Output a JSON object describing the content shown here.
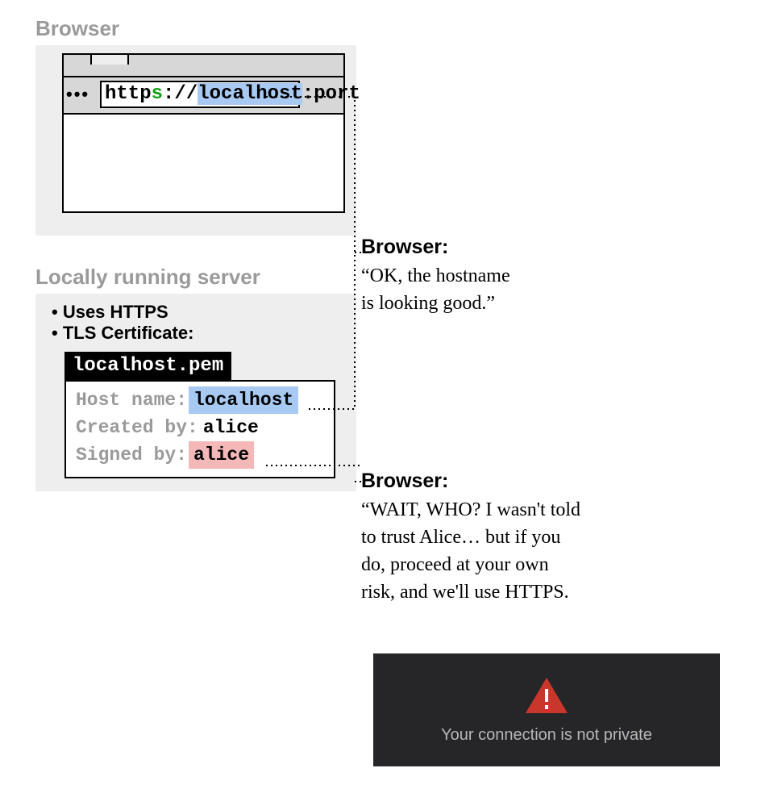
{
  "browser": {
    "title": "Browser",
    "dots": "•••",
    "url": {
      "scheme_http": "http",
      "scheme_s": "s",
      "sep": "://",
      "host": "localhost",
      "colon": ":",
      "port": "port"
    }
  },
  "server": {
    "title": "Locally running server",
    "bullets": [
      "Uses HTTPS",
      "TLS Certificate:"
    ],
    "cert_file": "localhost.pem",
    "cert": {
      "host_label": "Host name:",
      "host_value": "localhost",
      "created_label": "Created by:",
      "created_value": "alice",
      "signed_label": "Signed by:",
      "signed_value": "alice"
    }
  },
  "callout1": {
    "who": "Browser:",
    "speech": "“OK, the hostname\nis looking good.”"
  },
  "callout2": {
    "who": "Browser:",
    "speech": "“WAIT, WHO? I wasn't told\nto trust Alice… but if you\ndo, proceed at your own\nrisk, and we'll use HTTPS."
  },
  "warning": {
    "message": "Your connection is not private",
    "triangle_color": "#c9362b"
  }
}
